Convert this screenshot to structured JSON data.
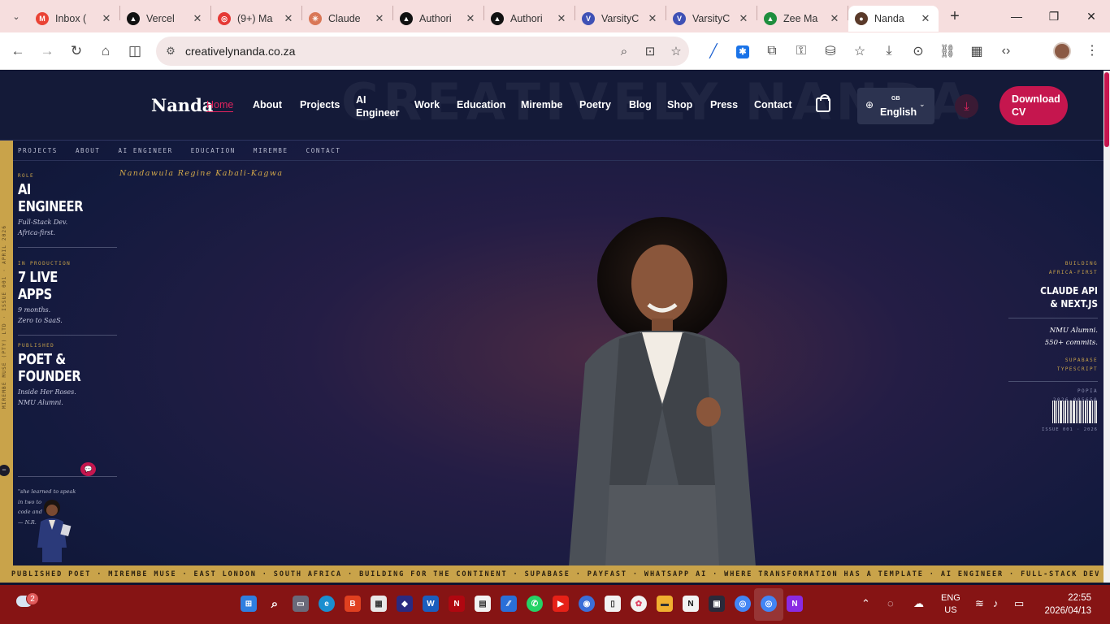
{
  "browser": {
    "tabs": [
      {
        "title": "Inbox (",
        "fav": "M",
        "color": "#ea4335"
      },
      {
        "title": "Vercel",
        "fav": "▲",
        "color": "#111111"
      },
      {
        "title": "(9+) Ma",
        "fav": "◎",
        "color": "#e53935"
      },
      {
        "title": "Claude",
        "fav": "✳",
        "color": "#d97757"
      },
      {
        "title": "Authori",
        "fav": "▲",
        "color": "#111111"
      },
      {
        "title": "Authori",
        "fav": "▲",
        "color": "#111111"
      },
      {
        "title": "VarsityC",
        "fav": "V",
        "color": "#3f51b5"
      },
      {
        "title": "VarsityC",
        "fav": "V",
        "color": "#3f51b5"
      },
      {
        "title": "Zee Ma",
        "fav": "▲",
        "color": "#1e8e3e"
      },
      {
        "title": "Nanda",
        "fav": "●",
        "color": "#5a3a2a"
      }
    ],
    "url": "creativelynanda.co.za"
  },
  "site": {
    "watermark": "CREATIVELY NANDA",
    "logo": "Nanda",
    "nav": {
      "home": "Home",
      "about": "About",
      "projects": "Projects",
      "ai_1": "AI",
      "ai_2": "Engineer",
      "work": "Work",
      "education": "Education",
      "mirembe": "Mirembe",
      "poetry": "Poetry",
      "blog": "Blog",
      "shop": "Shop",
      "press": "Press",
      "contact": "Contact"
    },
    "lang": {
      "code": "GB",
      "label": "English"
    },
    "download_cv_1": "Download",
    "download_cv_2": "CV",
    "subnav": [
      "PROJECTS",
      "ABOUT",
      "AI ENGINEER",
      "EDUCATION",
      "MIREMBE",
      "CONTACT"
    ],
    "name_line": "Nandawula Regine Kabali-Kagwa",
    "vertical_text": "MIREMBE MUSE (PTY) LTD · ISSUE 001 · APRIL 2026",
    "stats": [
      {
        "label": "ROLE",
        "line1": "AI",
        "line2": "ENGINEER",
        "it1": "Full-Stack Dev.",
        "it2": "Africa-first."
      },
      {
        "label": "IN PRODUCTION",
        "line1": "7 LIVE",
        "line2": "APPS",
        "it1": "9 months.",
        "it2": "Zero to SaaS."
      },
      {
        "label": "PUBLISHED",
        "line1": "POET &",
        "line2": "FOUNDER",
        "it1": "Inside Her Roses.",
        "it2": "NMU Alumni."
      }
    ],
    "quote": {
      "l1": "\"she learned to speak",
      "l2": "in two to",
      "l3": "code and",
      "l4": "— N.R."
    },
    "right": {
      "m1": "BUILDING",
      "m2": "AFRICA-FIRST",
      "big1": "CLAUDE API",
      "big2": "& NEXT.JS",
      "it1": "NMU Alumni.",
      "it2": "550+ commits.",
      "m3": "SUPABASE",
      "m4": "TYPESCRIPT",
      "m5": "POPIA",
      "m6": "2026-005650",
      "issue": "ISSUE 001 · 2026"
    },
    "ticker": "PUBLISHED POET  ·   MIREMBE MUSE  ·   EAST LONDON · SOUTH AFRICA  ·   BUILDING FOR THE CONTINENT  ·   SUPABASE · PAYFAST · WHATSAPP AI  ·   WHERE TRANSFORMATION HAS A TEMPLATE  ·   AI ENGINEER  ·   FULL-STACK DEV"
  },
  "taskbar": {
    "weather_badge": "2",
    "lang_1": "ENG",
    "lang_2": "US",
    "time": "22:55",
    "date": "2026/04/13"
  },
  "colors": {
    "accent": "#c5164e",
    "gold": "#c9a34a",
    "navy": "#141a38",
    "taskbar": "#861414"
  }
}
